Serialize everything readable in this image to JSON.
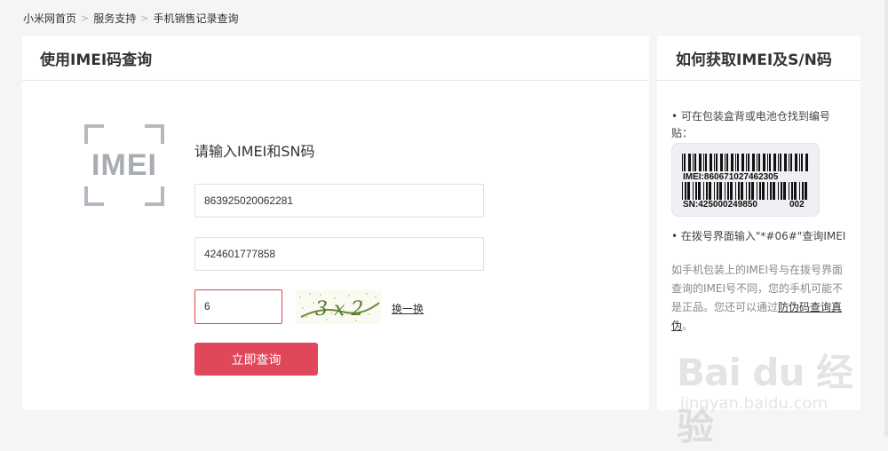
{
  "breadcrumb": {
    "items": [
      "小米网首页",
      "服务支持",
      "手机销售记录查询"
    ],
    "separator": ">"
  },
  "main": {
    "title": "使用IMEI码查询",
    "logo_text": "IMEI",
    "form_heading": "请输入IMEI和SN码",
    "imei_value": "863925020062281",
    "sn_value": "424601777858",
    "captcha_value": "6",
    "captcha_image_text": "3 x 2",
    "refresh_label": "换一换",
    "submit_label": "立即查询"
  },
  "sidebar": {
    "title": "如何获取IMEI及S/N码",
    "tip1": "可在包装盒背或电池仓找到编号贴：",
    "label_imei": "IMEI:860671027462305",
    "label_sn": "SN:425000249850",
    "label_code": "002",
    "tip2": "在拨号界面输入\"*#06#\"查询IMEI",
    "note_text": "如手机包装上的IMEI号与在拨号界面查询的IMEI号不同，您的手机可能不是正品。您还可以通过",
    "note_link": "防伪码查询真伪",
    "note_end": "。"
  },
  "watermark": {
    "main": "Bai du 经验",
    "sub": "jingyan.baidu.com"
  },
  "colors": {
    "accent": "#e0475a",
    "background": "#f5f5f5",
    "logo_gray": "#a9adb3"
  }
}
